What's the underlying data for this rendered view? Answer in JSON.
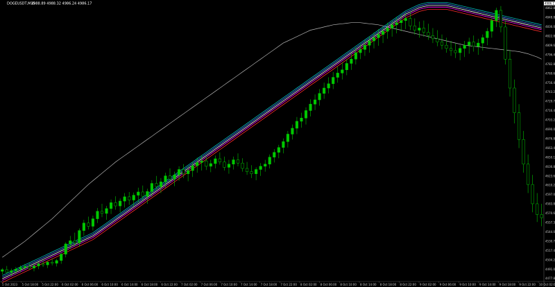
{
  "header": {
    "symbol": "DOGEUSDT,M15",
    "ohlc": "4988.89 4988.32 4986.24 4986.17"
  },
  "price_axis": {
    "labels": [
      "4862.80",
      "4848.88",
      "4836.08",
      "4822.80",
      "4809.60",
      "4796.40",
      "4782.80",
      "4769.60",
      "4756.40",
      "4743.20",
      "4729.70",
      "4716.40",
      "4703.20",
      "4690.00",
      "4676.80",
      "4663.40",
      "4650.10",
      "4636.80",
      "4623.60",
      "4610.20",
      "4597.00",
      "4583.80",
      "4570.60",
      "4557.30",
      "4544.00",
      "4530.70",
      "4517.40",
      "4504.20",
      "4491.00",
      "4477.80"
    ],
    "current_price": "4986.17"
  },
  "time_axis": {
    "labels": [
      "5 Oct 2023",
      "5 Oct 18:00",
      "5 Oct 22:00",
      "6 Oct 02:00",
      "6 Oct 06:00",
      "6 Oct 10:00",
      "6 Oct 14:00",
      "6 Oct 18:00",
      "6 Oct 22:00",
      "7 Oct 02:00",
      "7 Oct 06:00",
      "7 Oct 10:00",
      "7 Oct 14:00",
      "7 Oct 18:00",
      "7 Oct 22:00",
      "8 Oct 02:00",
      "8 Oct 06:00",
      "8 Oct 10:00",
      "8 Oct 14:00",
      "8 Oct 18:00",
      "8 Oct 22:00",
      "9 Oct 02:00",
      "9 Oct 06:00",
      "9 Oct 10:00",
      "9 Oct 14:00",
      "9 Oct 18:00",
      "9 Oct 22:00",
      "10 Oct 02:00"
    ]
  },
  "colors": {
    "background": "#000000",
    "candle": "#00c800",
    "sma": "#b4b4b4",
    "ma_red": "#ff2a2a",
    "ma_magenta": "#ff00ff",
    "ma_blue": "#4a7bff",
    "ma_white": "#ffffff",
    "ma_teal": "#00bcbc"
  },
  "chart_data": {
    "type": "candlestick",
    "y_range": [
      4475,
      4990
    ],
    "candles": [
      [
        4494,
        4500,
        4488,
        4497
      ],
      [
        4497,
        4504,
        4490,
        4492
      ],
      [
        4492,
        4499,
        4485,
        4495
      ],
      [
        4495,
        4502,
        4489,
        4498
      ],
      [
        4498,
        4505,
        4492,
        4501
      ],
      [
        4501,
        4508,
        4496,
        4503
      ],
      [
        4503,
        4509,
        4497,
        4500
      ],
      [
        4500,
        4507,
        4494,
        4504
      ],
      [
        4504,
        4511,
        4498,
        4508
      ],
      [
        4508,
        4515,
        4502,
        4506
      ],
      [
        4506,
        4514,
        4500,
        4511
      ],
      [
        4511,
        4518,
        4505,
        4509
      ],
      [
        4509,
        4517,
        4503,
        4514
      ],
      [
        4514,
        4528,
        4508,
        4526
      ],
      [
        4526,
        4548,
        4520,
        4545
      ],
      [
        4545,
        4560,
        4536,
        4551
      ],
      [
        4551,
        4566,
        4541,
        4547
      ],
      [
        4547,
        4574,
        4540,
        4570
      ],
      [
        4570,
        4590,
        4560,
        4584
      ],
      [
        4584,
        4596,
        4572,
        4578
      ],
      [
        4578,
        4598,
        4570,
        4592
      ],
      [
        4592,
        4612,
        4584,
        4606
      ],
      [
        4606,
        4620,
        4595,
        4602
      ],
      [
        4602,
        4616,
        4590,
        4611
      ],
      [
        4611,
        4628,
        4601,
        4622
      ],
      [
        4622,
        4634,
        4609,
        4616
      ],
      [
        4616,
        4630,
        4604,
        4625
      ],
      [
        4625,
        4640,
        4613,
        4633
      ],
      [
        4633,
        4642,
        4618,
        4627
      ],
      [
        4627,
        4641,
        4615,
        4636
      ],
      [
        4636,
        4650,
        4622,
        4642
      ],
      [
        4642,
        4654,
        4626,
        4634
      ],
      [
        4634,
        4648,
        4620,
        4643
      ],
      [
        4643,
        4664,
        4633,
        4658
      ],
      [
        4658,
        4672,
        4646,
        4652
      ],
      [
        4652,
        4668,
        4640,
        4661
      ],
      [
        4661,
        4678,
        4650,
        4672
      ],
      [
        4672,
        4686,
        4660,
        4666
      ],
      [
        4666,
        4680,
        4653,
        4674
      ],
      [
        4674,
        4690,
        4663,
        4684
      ],
      [
        4684,
        4694,
        4668,
        4676
      ],
      [
        4676,
        4690,
        4662,
        4682
      ],
      [
        4682,
        4698,
        4670,
        4691
      ],
      [
        4691,
        4706,
        4678,
        4697
      ],
      [
        4697,
        4710,
        4682,
        4700
      ],
      [
        4700,
        4708,
        4683,
        4690
      ],
      [
        4690,
        4702,
        4679,
        4695
      ],
      [
        4695,
        4710,
        4686,
        4704
      ],
      [
        4704,
        4716,
        4693,
        4698
      ],
      [
        4698,
        4708,
        4682,
        4688
      ],
      [
        4688,
        4702,
        4676,
        4694
      ],
      [
        4694,
        4708,
        4684,
        4702
      ],
      [
        4702,
        4714,
        4690,
        4696
      ],
      [
        4696,
        4705,
        4680,
        4686
      ],
      [
        4686,
        4698,
        4674,
        4680
      ],
      [
        4680,
        4692,
        4668,
        4676
      ],
      [
        4676,
        4688,
        4664,
        4684
      ],
      [
        4684,
        4696,
        4672,
        4690
      ],
      [
        4690,
        4702,
        4680,
        4694
      ],
      [
        4694,
        4712,
        4686,
        4707
      ],
      [
        4707,
        4722,
        4697,
        4716
      ],
      [
        4716,
        4730,
        4705,
        4725
      ],
      [
        4725,
        4742,
        4714,
        4736
      ],
      [
        4736,
        4756,
        4725,
        4750
      ],
      [
        4750,
        4768,
        4740,
        4761
      ],
      [
        4761,
        4782,
        4750,
        4774
      ],
      [
        4774,
        4790,
        4762,
        4780
      ],
      [
        4780,
        4800,
        4768,
        4794
      ],
      [
        4794,
        4815,
        4783,
        4806
      ],
      [
        4806,
        4824,
        4795,
        4814
      ],
      [
        4814,
        4834,
        4803,
        4826
      ],
      [
        4826,
        4846,
        4816,
        4836
      ],
      [
        4836,
        4856,
        4826,
        4844
      ],
      [
        4844,
        4866,
        4834,
        4856
      ],
      [
        4856,
        4876,
        4846,
        4864
      ],
      [
        4864,
        4884,
        4852,
        4870
      ],
      [
        4870,
        4890,
        4860,
        4882
      ],
      [
        4882,
        4900,
        4870,
        4890
      ],
      [
        4890,
        4912,
        4880,
        4902
      ],
      [
        4902,
        4918,
        4890,
        4908
      ],
      [
        4908,
        4926,
        4896,
        4916
      ],
      [
        4916,
        4932,
        4902,
        4924
      ],
      [
        4924,
        4940,
        4910,
        4930
      ],
      [
        4930,
        4946,
        4915,
        4936
      ],
      [
        4936,
        4950,
        4920,
        4942
      ],
      [
        4942,
        4958,
        4928,
        4948
      ],
      [
        4948,
        4962,
        4932,
        4954
      ],
      [
        4954,
        4968,
        4938,
        4958
      ],
      [
        4958,
        4972,
        4942,
        4962
      ],
      [
        4962,
        4976,
        4946,
        4966
      ],
      [
        4966,
        4978,
        4944,
        4952
      ],
      [
        4952,
        4966,
        4936,
        4944
      ],
      [
        4944,
        4960,
        4930,
        4948
      ],
      [
        4948,
        4962,
        4932,
        4940
      ],
      [
        4940,
        4956,
        4926,
        4934
      ],
      [
        4934,
        4948,
        4920,
        4928
      ],
      [
        4928,
        4944,
        4914,
        4922
      ],
      [
        4922,
        4936,
        4908,
        4916
      ],
      [
        4916,
        4930,
        4902,
        4910
      ],
      [
        4910,
        4924,
        4896,
        4906
      ],
      [
        4906,
        4920,
        4892,
        4902
      ],
      [
        4902,
        4916,
        4888,
        4910
      ],
      [
        4910,
        4924,
        4894,
        4916
      ],
      [
        4916,
        4930,
        4900,
        4922
      ],
      [
        4922,
        4934,
        4904,
        4914
      ],
      [
        4914,
        4928,
        4898,
        4920
      ],
      [
        4920,
        4936,
        4906,
        4930
      ],
      [
        4930,
        4948,
        4916,
        4942
      ],
      [
        4942,
        4968,
        4930,
        4962
      ],
      [
        4962,
        4986,
        4950,
        4981
      ],
      [
        4981,
        4989,
        4940,
        4950
      ],
      [
        4950,
        4962,
        4880,
        4890
      ],
      [
        4890,
        4906,
        4820,
        4836
      ],
      [
        4836,
        4852,
        4770,
        4790
      ],
      [
        4790,
        4806,
        4724,
        4740
      ],
      [
        4740,
        4756,
        4678,
        4694
      ],
      [
        4694,
        4712,
        4640,
        4656
      ],
      [
        4656,
        4674,
        4604,
        4620
      ],
      [
        4620,
        4640,
        4586,
        4600
      ],
      [
        4600,
        4620,
        4578,
        4594
      ]
    ],
    "sma_line": [
      4520,
      4526,
      4532,
      4538,
      4544,
      4550,
      4557,
      4564,
      4571,
      4578,
      4585,
      4592,
      4600,
      4608,
      4616,
      4624,
      4632,
      4640,
      4648,
      4656,
      4663,
      4670,
      4677,
      4684,
      4691,
      4698,
      4704,
      4710,
      4716,
      4722,
      4728,
      4734,
      4740,
      4746,
      4752,
      4758,
      4764,
      4770,
      4776,
      4782,
      4788,
      4794,
      4800,
      4806,
      4812,
      4818,
      4824,
      4830,
      4836,
      4842,
      4848,
      4854,
      4860,
      4866,
      4872,
      4878,
      4884,
      4890,
      4896,
      4902,
      4908,
      4914,
      4920,
      4924,
      4928,
      4932,
      4936,
      4940,
      4944,
      4946,
      4948,
      4950,
      4952,
      4954,
      4955,
      4956,
      4957,
      4958,
      4958,
      4958,
      4957,
      4956,
      4955,
      4954,
      4952,
      4950,
      4948,
      4946,
      4944,
      4942,
      4940,
      4938,
      4936,
      4934,
      4932,
      4930,
      4928,
      4926,
      4924,
      4922,
      4920,
      4918,
      4916,
      4915,
      4914,
      4913,
      4912,
      4911,
      4910,
      4909,
      4908,
      4907,
      4906,
      4905,
      4904,
      4902,
      4900,
      4897,
      4894,
      4890
    ],
    "ma_band": [
      4480,
      4484,
      4488,
      4492,
      4496,
      4500,
      4504,
      4508,
      4512,
      4516,
      4520,
      4524,
      4528,
      4532,
      4536,
      4540,
      4544,
      4548,
      4552,
      4556,
      4560,
      4566,
      4572,
      4578,
      4584,
      4590,
      4596,
      4602,
      4608,
      4614,
      4620,
      4626,
      4632,
      4638,
      4644,
      4650,
      4656,
      4662,
      4668,
      4674,
      4680,
      4686,
      4692,
      4698,
      4704,
      4710,
      4716,
      4722,
      4728,
      4734,
      4740,
      4746,
      4752,
      4758,
      4764,
      4770,
      4776,
      4782,
      4788,
      4794,
      4800,
      4806,
      4812,
      4818,
      4824,
      4830,
      4836,
      4842,
      4848,
      4854,
      4860,
      4866,
      4872,
      4878,
      4884,
      4890,
      4896,
      4902,
      4908,
      4914,
      4920,
      4926,
      4932,
      4938,
      4944,
      4950,
      4956,
      4962,
      4968,
      4974,
      4978,
      4982,
      4986,
      4988,
      4990,
      4990,
      4990,
      4990,
      4990,
      4988,
      4986,
      4984,
      4982,
      4980,
      4978,
      4976,
      4974,
      4972,
      4970,
      4968,
      4966,
      4964,
      4962,
      4960,
      4958,
      4956,
      4954,
      4952,
      4950,
      4948
    ]
  }
}
